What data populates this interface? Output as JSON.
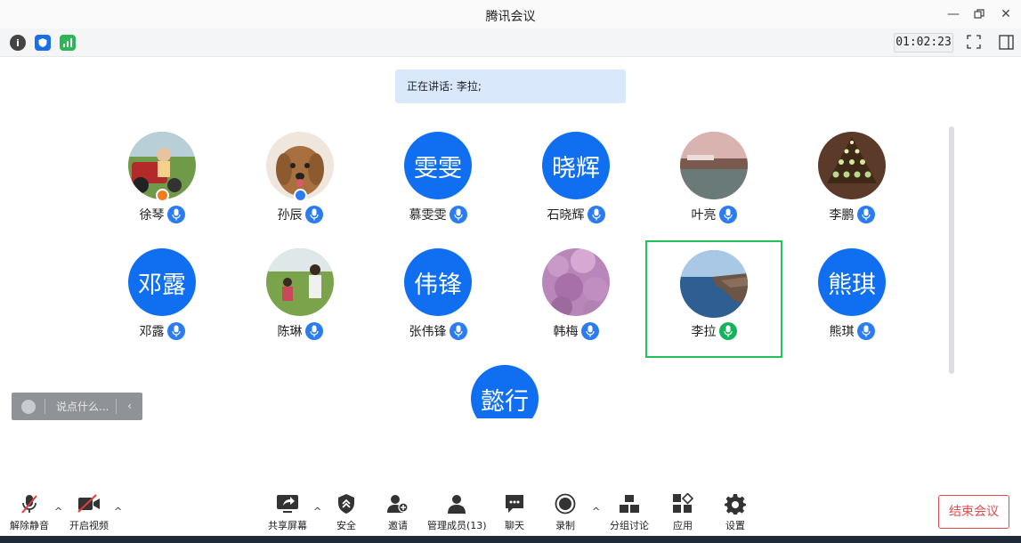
{
  "window": {
    "title": "腾讯会议"
  },
  "infobar": {
    "timer": "01:02:23"
  },
  "speaking": {
    "text": "正在讲话: 李拉;"
  },
  "participants": [
    {
      "name": "徐琴",
      "avatar_text": "",
      "photo": "child-on-tractor",
      "badge": "orange"
    },
    {
      "name": "孙辰",
      "avatar_text": "",
      "photo": "dog",
      "badge": "blue"
    },
    {
      "name": "慕雯雯",
      "avatar_text": "雯雯"
    },
    {
      "name": "石晓辉",
      "avatar_text": "晓辉"
    },
    {
      "name": "叶亮",
      "avatar_text": "",
      "photo": "landscape"
    },
    {
      "name": "李鹏",
      "avatar_text": "",
      "photo": "tree-lights"
    },
    {
      "name": "邓露",
      "avatar_text": "邓露"
    },
    {
      "name": "陈琳",
      "avatar_text": "",
      "photo": "people-field"
    },
    {
      "name": "张伟锋",
      "avatar_text": "伟锋"
    },
    {
      "name": "韩梅",
      "avatar_text": "",
      "photo": "blossoms"
    },
    {
      "name": "李拉",
      "avatar_text": "",
      "photo": "sea-cliff",
      "speaking": true
    },
    {
      "name": "熊琪",
      "avatar_text": "熊琪"
    },
    {
      "name": "",
      "avatar_text": "懿行"
    }
  ],
  "chat": {
    "placeholder": "说点什么..."
  },
  "toolbar": {
    "unmute": "解除静音",
    "video": "开启视频",
    "share": "共享屏幕",
    "security": "安全",
    "invite": "邀请",
    "members": "管理成员(13)",
    "chat": "聊天",
    "record": "录制",
    "breakout": "分组讨论",
    "apps": "应用",
    "settings": "设置",
    "end": "结束会议"
  },
  "colors": {
    "accent": "#0f6ff0",
    "speaking": "#21c25a",
    "end": "#e24b4b"
  }
}
